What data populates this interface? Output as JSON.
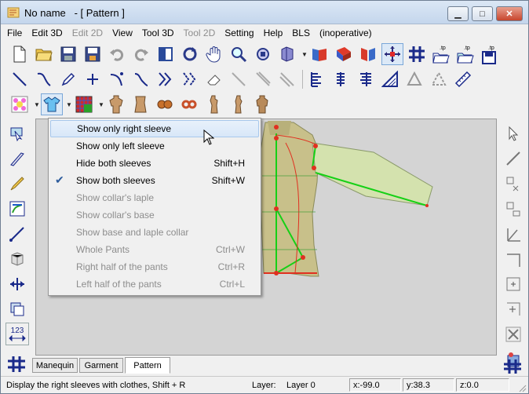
{
  "window": {
    "title": "No name   - [ Pattern ]",
    "min_label": "▁",
    "max_label": "□",
    "close_label": "✕"
  },
  "menubar": {
    "items": [
      {
        "label": "File",
        "disabled": false
      },
      {
        "label": "Edit 3D",
        "disabled": false
      },
      {
        "label": "Edit 2D",
        "disabled": true
      },
      {
        "label": "View",
        "disabled": false
      },
      {
        "label": "Tool 3D",
        "disabled": false
      },
      {
        "label": "Tool 2D",
        "disabled": true
      },
      {
        "label": "Setting",
        "disabled": false
      },
      {
        "label": "Help",
        "disabled": false
      },
      {
        "label": "BLS",
        "disabled": false
      },
      {
        "label": "(inoperative)",
        "disabled": false
      }
    ]
  },
  "toolbar1": {
    "icons": [
      "new-file-icon",
      "open-folder-icon",
      "save-icon",
      "save-as-icon",
      "undo-icon",
      "redo-icon",
      "split-view-icon",
      "rotate-icon",
      "hand-pan-icon",
      "zoom-icon",
      "zoom-fit-icon",
      "mannequin-view-icon",
      "flat-pattern-icon",
      "red-fabric-icon",
      "pattern-piece-icon",
      "move-cross-icon",
      "grid-icon",
      "tp-open-icon",
      "tp-open-2-icon",
      "tp-save-icon"
    ],
    "tp_label": ".tp"
  },
  "toolbar2": {
    "icons": [
      "line-tool-icon",
      "curve-tool-icon",
      "pencil-tool-icon",
      "point-tool-icon",
      "bezier-tool-icon",
      "curve-edit-icon",
      "dart-tool-icon",
      "pleat-tool-icon",
      "eraser-tool-icon",
      "disabled-line-icon",
      "disabled-double-line-icon",
      "disabled-mirror-icon",
      "vertical-measure-icon",
      "vertical-measure-2-icon",
      "vertical-measure-3-icon",
      "hatch-tool-icon",
      "triangle-tool-icon",
      "triangle-tool-2-icon",
      "ruler-icon"
    ]
  },
  "toolbar3": {
    "icons": [
      "fabric-flower-icon",
      "garment-shirt-icon",
      "texture-grid-icon",
      "mannequin-front-icon",
      "mannequin-torso-icon",
      "mannequin-bra-icon",
      "mannequin-rings-icon",
      "mannequin-side-icon",
      "mannequin-side-2-icon",
      "mannequin-back-icon"
    ]
  },
  "lefttool": {
    "icons": [
      "select-shape-icon",
      "knife-icon",
      "brush-icon",
      "transform-icon",
      "line-draw-icon",
      "cube-view-icon",
      "width-arrow-icon",
      "layers-icon",
      "measure-123-icon"
    ],
    "measure_label": "123"
  },
  "dropdown": {
    "items": [
      {
        "label": "Show only right sleeve",
        "shortcut": "",
        "disabled": false,
        "checked": false,
        "hover": true
      },
      {
        "label": "Show only left sleeve",
        "shortcut": "",
        "disabled": false,
        "checked": false,
        "hover": false
      },
      {
        "label": "Hide both sleeves",
        "shortcut": "Shift+H",
        "disabled": false,
        "checked": false,
        "hover": false
      },
      {
        "label": "Show both sleeves",
        "shortcut": "Shift+W",
        "disabled": false,
        "checked": true,
        "hover": false
      },
      {
        "label": "Show collar's laple",
        "shortcut": "",
        "disabled": true,
        "checked": false,
        "hover": false
      },
      {
        "label": "Show collar's base",
        "shortcut": "",
        "disabled": true,
        "checked": false,
        "hover": false
      },
      {
        "label": "Show base and laple collar",
        "shortcut": "",
        "disabled": true,
        "checked": false,
        "hover": false
      },
      {
        "label": "Whole Pants",
        "shortcut": "Ctrl+W",
        "disabled": true,
        "checked": false,
        "hover": false
      },
      {
        "label": "Right half of the pants",
        "shortcut": "Ctrl+R",
        "disabled": true,
        "checked": false,
        "hover": false
      },
      {
        "label": "Left half of the pants",
        "shortcut": "Ctrl+L",
        "disabled": true,
        "checked": false,
        "hover": false
      }
    ],
    "check_glyph": "✔"
  },
  "tabs": [
    {
      "label": "Manequin",
      "active": false
    },
    {
      "label": "Garment",
      "active": false
    },
    {
      "label": "Pattern",
      "active": true
    }
  ],
  "statusbar": {
    "message": "Display the right sleeves with clothes, Shift + R",
    "layer_label": "Layer:",
    "layer_value": "Layer 0",
    "x": "x:-99.0",
    "y": "y:38.3",
    "z": "z:0.0"
  },
  "colors": {
    "accent": "#3399ff",
    "pattern_line": "#e03020",
    "pattern_green": "#16d016",
    "body_fill": "#c8c08a"
  }
}
